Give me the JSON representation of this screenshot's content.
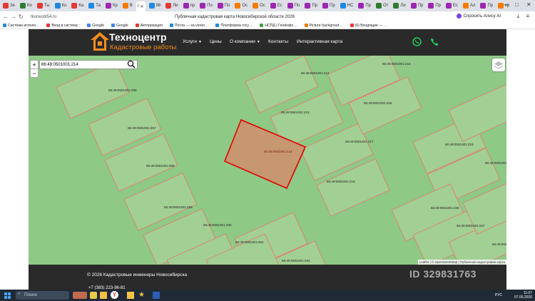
{
  "browser": {
    "tabs": [
      {
        "label": "Зе",
        "color": "#e53935"
      },
      {
        "label": "Ко",
        "color": "#2e7d32"
      },
      {
        "label": "Ты",
        "color": "#e53935"
      },
      {
        "label": "Ко",
        "color": "#1e88e5"
      },
      {
        "label": "Ка",
        "color": "#e53935"
      },
      {
        "label": "Та",
        "color": "#1e88e5"
      },
      {
        "label": "Кр",
        "color": "#9c27b0"
      },
      {
        "label": "В",
        "color": "#f57c00"
      },
      {
        "label": "98",
        "color": "#1e88e5"
      },
      {
        "label": "Ли",
        "color": "#e53935"
      },
      {
        "label": "пр",
        "color": "#9c27b0"
      },
      {
        "label": "По",
        "color": "#9c27b0"
      },
      {
        "label": "По",
        "color": "#9c27b0"
      },
      {
        "label": "Ос",
        "color": "#f57c00"
      },
      {
        "label": "Ос",
        "color": "#f57c00"
      },
      {
        "label": "Ес",
        "color": "#9c27b0"
      },
      {
        "label": "По",
        "color": "#9c27b0"
      },
      {
        "label": "Пр",
        "color": "#9c27b0"
      },
      {
        "label": "Пр",
        "color": "#9c27b0"
      },
      {
        "label": "НС",
        "color": "#1e88e5"
      },
      {
        "label": "Пр",
        "color": "#9c27b0"
      },
      {
        "label": "От",
        "color": "#2e7d32"
      },
      {
        "label": "Ли",
        "color": "#2e7d32"
      },
      {
        "label": "Пр",
        "color": "#9c27b0"
      },
      {
        "label": "Пр",
        "color": "#9c27b0"
      },
      {
        "label": "Ес",
        "color": "#9c27b0"
      },
      {
        "label": "Ал",
        "color": "#f57c00"
      },
      {
        "label": "Пр",
        "color": "#9c27b0"
      },
      {
        "label": "кр",
        "color": "#f57c00"
      }
    ],
    "active_tab": "I",
    "address": "tkunesbt54.ru",
    "page_title": "Публичная кадастровая карта Новосибирской области 2026",
    "alice": "Спросить Алису AI",
    "bookmarks": [
      "Система исполн…",
      "Вход в систему ;",
      "Google",
      "Google",
      "Авторизация",
      "Почта — sa.veren…",
      "Платформа госу…",
      "НСПД | Геоинфо…",
      "Picture backgroud…",
      "(6) Входящие — …"
    ]
  },
  "site": {
    "logo_title": "Техноцентр",
    "logo_subtitle": "Кадастровые работы",
    "menu": [
      "Услуги",
      "Цены",
      "О компании",
      "Контакты",
      "Интерактивная карта"
    ],
    "brand_color": "#f28c1e"
  },
  "map": {
    "search_value": "66:49:0501001:214",
    "zoom_in": "+",
    "zoom_out": "−",
    "attribution": "Leaflet | © OpenStreetMap | Публичная кадастровая карта",
    "parcels": [
      "66:49:0501001:212",
      "66:49:0501001:215",
      "66:49:0501001:256",
      "66:49:0501001:216",
      "66:49:0501001:213",
      "66:49:0501001:257",
      "66:49:0501001:217",
      "66:49:0501001:214",
      "66:49:0501001:219",
      "66:49:0501001:258",
      "66:49:0501001:220",
      "66:49:0501001:218",
      "66:49:0501001:259",
      "66:49:0501001:226",
      "66:49:0501001:260",
      "66:49:0501001:227",
      "66:49:0501001:261",
      "66:49:0501001:22",
      "66:49:0501001:262"
    ],
    "selected": "66:49:0501001:214"
  },
  "footer": {
    "copyright": "© 2026 Кадастровые инженеры Новосибирска",
    "phone": "+7 (383) 223-96-81"
  },
  "watermark": "ID 329831763",
  "taskbar": {
    "search": "Поиск",
    "time": "11:07",
    "date": "07.05.2026",
    "lang": "РУС"
  }
}
